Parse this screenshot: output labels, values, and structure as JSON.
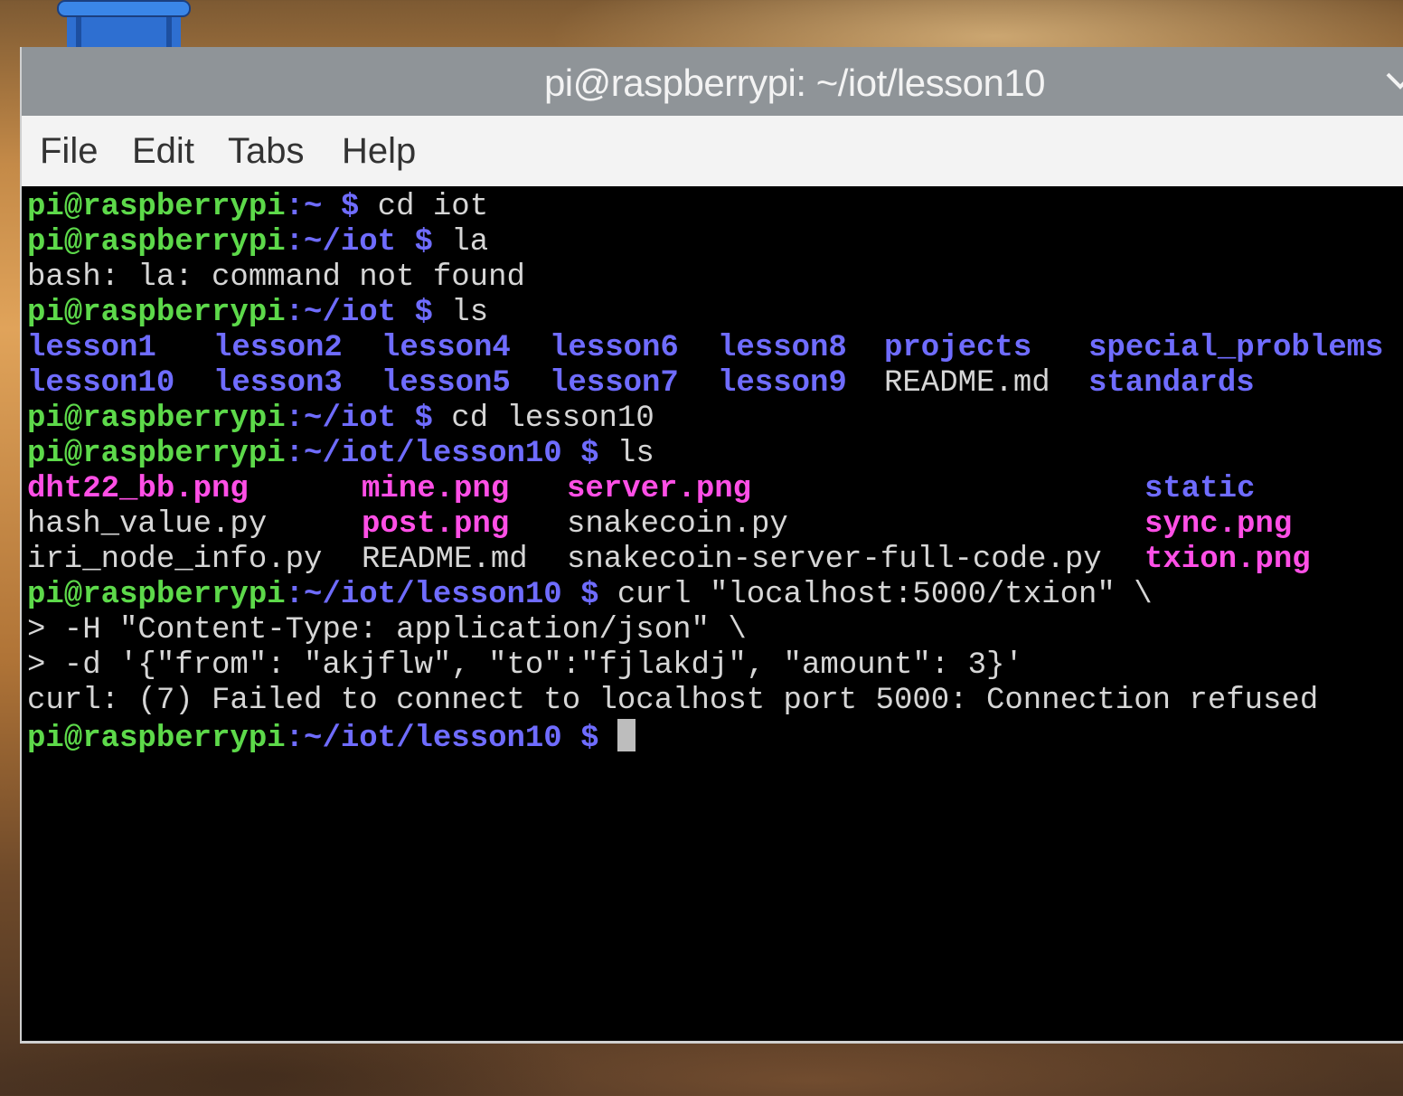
{
  "window": {
    "title": "pi@raspberrypi: ~/iot/lesson10"
  },
  "menu": {
    "file": "File",
    "edit": "Edit",
    "tabs": "Tabs",
    "help": "Help"
  },
  "colors": {
    "prompt_user": "#5dd94a",
    "prompt_path": "#6f6cff",
    "directory": "#6f6cff",
    "image_file": "#ff4fe6",
    "plain_text": "#d6d6d6",
    "background": "#000000"
  },
  "terminal": {
    "prompt_user": "pi@raspberrypi",
    "lines": [
      {
        "path": ":~",
        "sym": " $",
        "cmd": " cd iot"
      },
      {
        "path": ":~/iot",
        "sym": " $",
        "cmd": " la"
      },
      {
        "text": "bash: la: command not found"
      },
      {
        "path": ":~/iot",
        "sym": " $",
        "cmd": " ls"
      },
      {
        "path": ":~/iot/lesson10",
        "sym": " $",
        "cmd": " cd lesson10"
      },
      {
        "path": ":~/iot/lesson10",
        "sym": " $",
        "cmd": " ls"
      },
      {
        "path": ":~/iot/lesson10",
        "sym": " $",
        "cmd": " curl \"localhost:5000/txion\" \\"
      },
      {
        "text": "> -H \"Content-Type: application/json\" \\"
      },
      {
        "text": "> -d '{\"from\": \"akjflw\", \"to\":\"fjlakdj\", \"amount\": 3}'"
      },
      {
        "text": "curl: (7) Failed to connect to localhost port 5000: Connection refused"
      },
      {
        "path": ":~/iot/lesson10",
        "sym": " $",
        "cmd": " "
      }
    ],
    "ls_iot": [
      [
        "lesson1",
        "lesson2",
        "lesson4",
        "lesson6",
        "lesson8",
        "projects",
        "special_problems"
      ],
      [
        "lesson10",
        "lesson3",
        "lesson5",
        "lesson7",
        "lesson9",
        "README.md",
        "standards"
      ]
    ],
    "ls_lesson10": [
      [
        "dht22_bb.png",
        "mine.png",
        "server.png",
        "static"
      ],
      [
        "hash_value.py",
        "post.png",
        "snakecoin.py",
        "sync.png"
      ],
      [
        "iri_node_info.py",
        "README.md",
        "snakecoin-server-full-code.py",
        "txion.png"
      ]
    ]
  }
}
